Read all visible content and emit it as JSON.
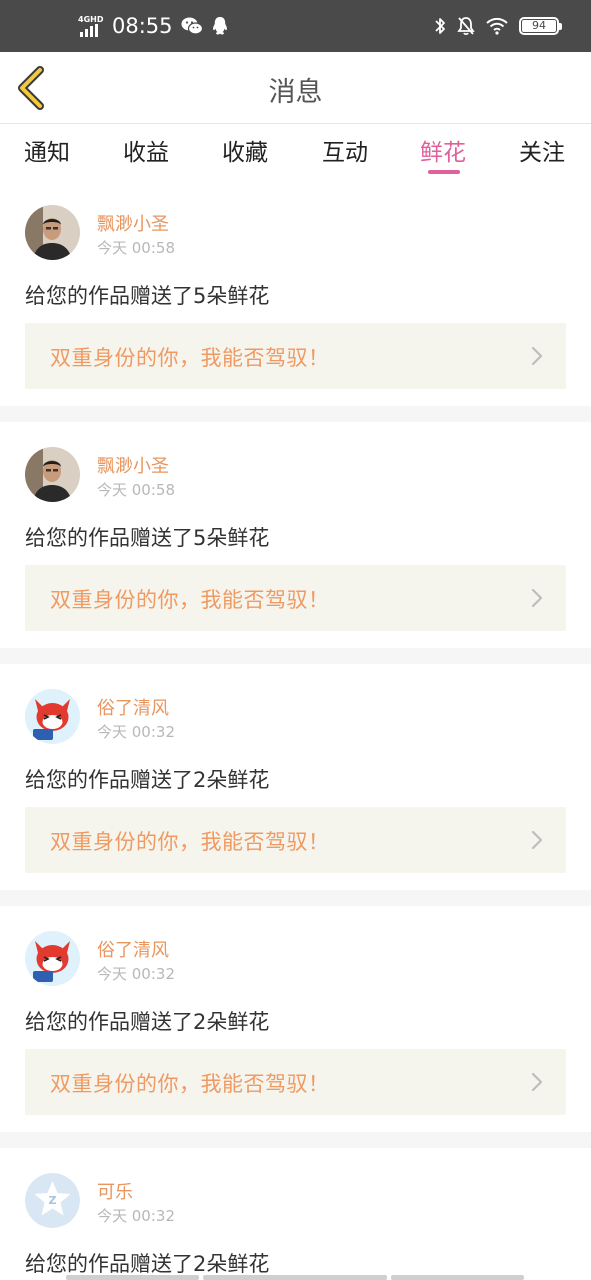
{
  "status_bar": {
    "network": "4GHD",
    "time": "08:55",
    "battery": "94",
    "icons": [
      "wechat-icon",
      "qq-icon",
      "bluetooth-icon",
      "mute-bell-icon",
      "wifi-icon"
    ]
  },
  "header": {
    "title": "消息",
    "back_icon": "back-chevron-icon"
  },
  "tabs": [
    {
      "label": "通知",
      "active": false
    },
    {
      "label": "收益",
      "active": false
    },
    {
      "label": "收藏",
      "active": false
    },
    {
      "label": "互动",
      "active": false
    },
    {
      "label": "鲜花",
      "active": true
    },
    {
      "label": "关注",
      "active": false
    }
  ],
  "colors": {
    "accent_pink": "#e0609b",
    "username_orange": "#e8965f",
    "work_title_orange": "#ef9a62",
    "work_bg": "#f5f5ee",
    "status_bar_bg": "#4a4a4a"
  },
  "messages": [
    {
      "user": "飘渺小圣",
      "time": "今天 00:58",
      "text": "给您的作品赠送了5朵鲜花",
      "work_title": "双重身份的你，我能否驾驭！",
      "avatar": "man-photo-avatar"
    },
    {
      "user": "飘渺小圣",
      "time": "今天 00:58",
      "text": "给您的作品赠送了5朵鲜花",
      "work_title": "双重身份的你，我能否驾驭！",
      "avatar": "man-photo-avatar"
    },
    {
      "user": "俗了清风",
      "time": "今天 00:32",
      "text": "给您的作品赠送了2朵鲜花",
      "work_title": "双重身份的你，我能否驾驭！",
      "avatar": "cartoon-fox-avatar"
    },
    {
      "user": "俗了清风",
      "time": "今天 00:32",
      "text": "给您的作品赠送了2朵鲜花",
      "work_title": "双重身份的你，我能否驾驭！",
      "avatar": "cartoon-fox-avatar"
    },
    {
      "user": "可乐",
      "time": "今天 00:32",
      "text": "给您的作品赠送了2朵鲜花",
      "work_title": "",
      "avatar": "default-star-avatar"
    }
  ]
}
